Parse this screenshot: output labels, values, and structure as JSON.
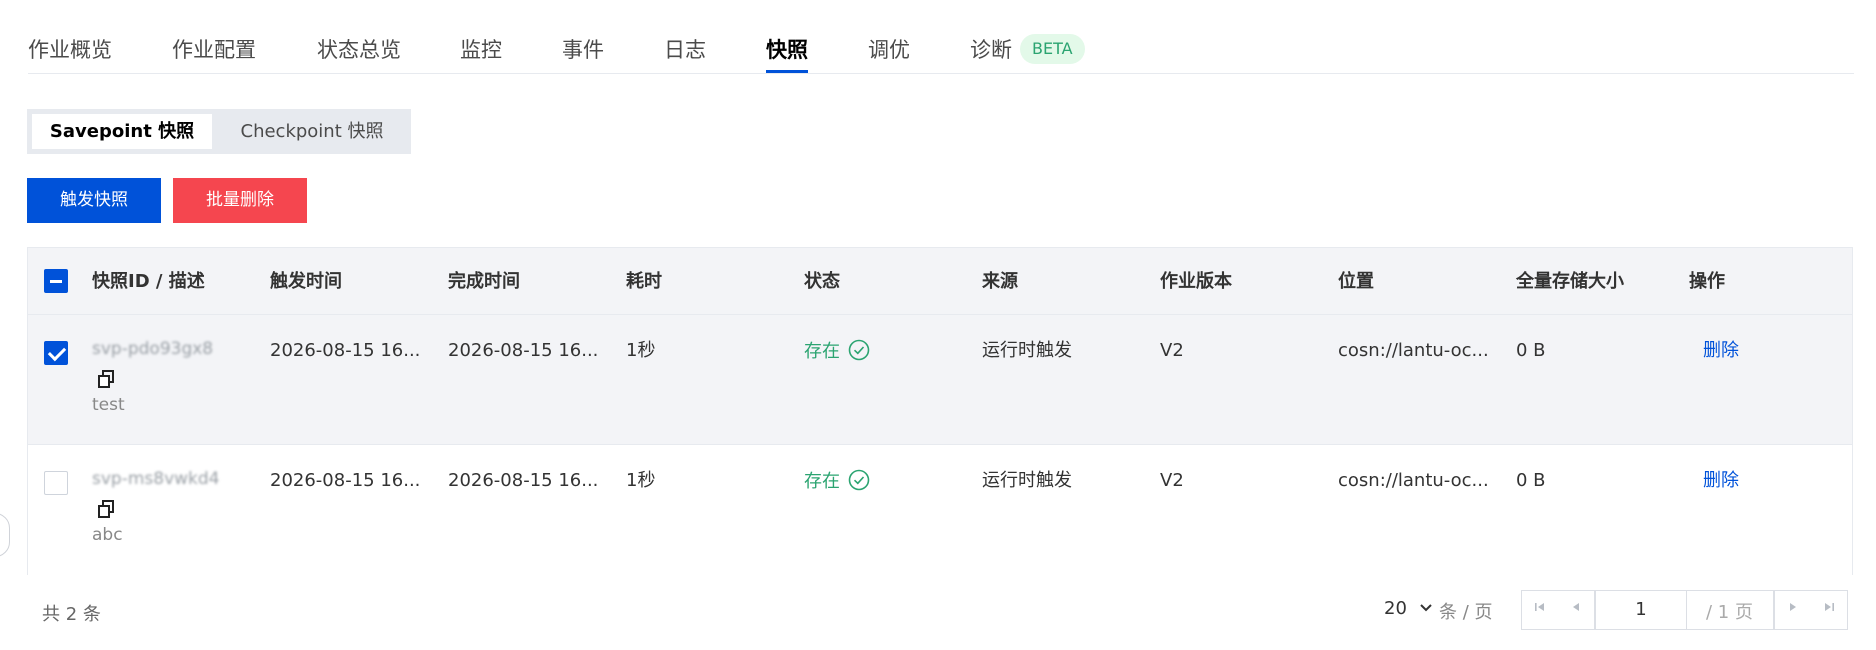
{
  "tabs": [
    {
      "label": "作业概览"
    },
    {
      "label": "作业配置"
    },
    {
      "label": "状态总览"
    },
    {
      "label": "监控"
    },
    {
      "label": "事件"
    },
    {
      "label": "日志"
    },
    {
      "label": "快照",
      "active": true
    },
    {
      "label": "调优"
    },
    {
      "label": "诊断",
      "badge": "BETA"
    }
  ],
  "segment": {
    "savepoint": "Savepoint 快照",
    "checkpoint": "Checkpoint 快照",
    "selected": "savepoint"
  },
  "toolbar": {
    "trigger_label": "触发快照",
    "batch_delete_label": "批量删除"
  },
  "table": {
    "columns": [
      "快照ID / 描述",
      "触发时间",
      "完成时间",
      "耗时",
      "状态",
      "来源",
      "作业版本",
      "位置",
      "全量存储大小",
      "操作"
    ],
    "rows": [
      {
        "checked": true,
        "id": "svp-pdo93gx8",
        "description": "test",
        "trigger_time": "2026-08-15 16...",
        "finish_time": "2026-08-15 16...",
        "duration": "1秒",
        "status": "存在",
        "source": "运行时触发",
        "version": "V2",
        "location": "cosn://lantu-oc...",
        "size": "0 B",
        "action": "删除"
      },
      {
        "checked": false,
        "id": "svp-ms8vwkd4",
        "description": "abc",
        "trigger_time": "2026-08-15 16...",
        "finish_time": "2026-08-15 16...",
        "duration": "1秒",
        "status": "存在",
        "source": "运行时触发",
        "version": "V2",
        "location": "cosn://lantu-oc...",
        "size": "0 B",
        "action": "删除"
      }
    ]
  },
  "footer": {
    "total": "共 2 条",
    "page_size": "20",
    "per_page_suffix": "条 / 页",
    "current_page": "1",
    "total_pages": "/ 1 页"
  },
  "colors": {
    "primary": "#0052d9",
    "danger": "#f5464f",
    "success": "#2ba471"
  }
}
